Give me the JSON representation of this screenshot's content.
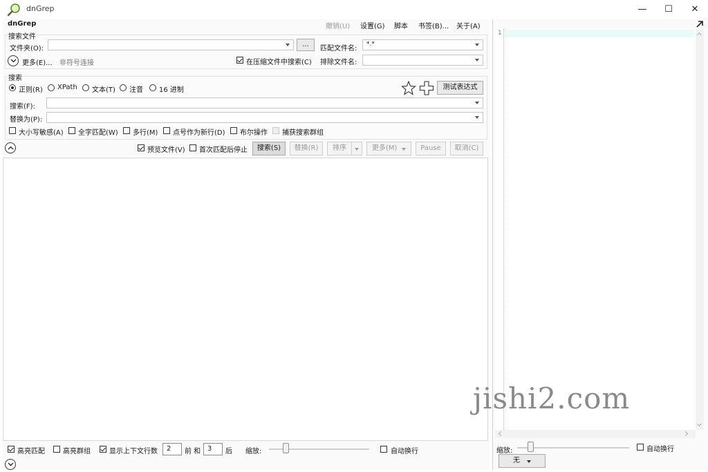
{
  "window": {
    "title": "dnGrep",
    "minimize_glyph": "—",
    "maximize_glyph": "☐",
    "close_glyph": "✕"
  },
  "app_name": "dnGrep",
  "menu": {
    "undo": "撤销(U)",
    "settings": "设置(G)",
    "scripts": "脚本",
    "bookmarks": "书签(B)...",
    "about": "关于(A)"
  },
  "search_files": {
    "group_label": "搜索文件",
    "folder_label": "文件夹(O):",
    "folder_value": "",
    "browse_button": "...",
    "file_pattern_label": "匹配文件名:",
    "file_pattern_value": "*.*",
    "more_label": "更多(E)...",
    "symlink_label": "非符号连接",
    "search_archives_label": "在压缩文件中搜索(C)",
    "search_archives_checked": true,
    "exclude_label": "排除文件名:",
    "exclude_value": ""
  },
  "search": {
    "group_label": "搜索",
    "modes": [
      {
        "label": "正则(R)",
        "checked": true
      },
      {
        "label": "XPath",
        "checked": false
      },
      {
        "label": "文本(T)",
        "checked": false
      },
      {
        "label": "注音",
        "checked": false
      },
      {
        "label": "16 进制",
        "checked": false
      }
    ],
    "test_expression_button": "测试表达式",
    "search_label": "搜索(F):",
    "search_value": "",
    "replace_label": "替换为(P):",
    "replace_value": "",
    "options": [
      {
        "label": "大小写敏感(A)",
        "checked": false
      },
      {
        "label": "全字匹配(W)",
        "checked": false
      },
      {
        "label": "多行(M)",
        "checked": false
      },
      {
        "label": "点号作为新行(D)",
        "checked": false
      },
      {
        "label": "布尔操作",
        "checked": false
      },
      {
        "label": "捕获搜索群组",
        "checked": false,
        "disabled": true
      }
    ]
  },
  "actions": {
    "preview_file_label": "预览文件(V)",
    "preview_file_checked": true,
    "stop_first_label": "首次匹配后停止",
    "stop_first_checked": false,
    "search_button": "搜索(S)",
    "replace_button": "替换(R)",
    "sort_button": "排序",
    "more_button": "更多(M)",
    "pause_button": "Pause",
    "cancel_button": "取消(C)"
  },
  "bottom": {
    "highlight_matches_label": "高亮匹配",
    "highlight_matches_checked": true,
    "highlight_groups_label": "高亮群组",
    "highlight_groups_checked": false,
    "show_context_label": "显示上下文行数",
    "show_context_checked": true,
    "before_value": "2",
    "before_label": "前 和",
    "after_value": "3",
    "after_label": "后",
    "zoom_label": "缩放:",
    "zoom_level": 0.15,
    "wrap_label": "自动换行",
    "wrap_checked": false
  },
  "preview": {
    "line_number": "1",
    "zoom_label": "缩放:",
    "zoom_level": 0.1,
    "wrap_label": "自动换行",
    "wrap_checked": false,
    "syntax_button": "无"
  },
  "watermark": "jishi2.com"
}
